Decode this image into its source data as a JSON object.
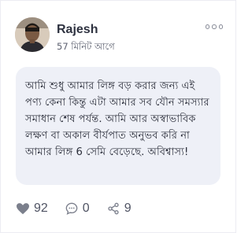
{
  "post": {
    "author_name": "Rajesh",
    "time_ago": "57 মিনিট আগে",
    "body_text": "আমি শুধু আমার লিঙ্গ বড় করার জন্য এই পণ্য কেনা কিন্তু এটা আমার সব যৌন সমস্যার সমাধান শেষ পর্যন্ত. আমি আর অস্বাভাবিক লক্ষণ বা অকাল বীর্যপাত অনুভব করি না আমার লিঙ্গ 6 সেমি বেড়েছে. অবিশ্বাস্য!"
  },
  "actions": {
    "likes_count": "92",
    "comments_count": "0",
    "shares_count": "9"
  },
  "icons": {
    "more": "more-horizontal-icon",
    "like": "heart-icon",
    "comment": "comment-bubble-icon",
    "share": "share-icon"
  },
  "colors": {
    "bubble_background": "#eef0f7",
    "text": "#2b2e3a",
    "muted": "#5d6170",
    "icon": "#505464"
  }
}
